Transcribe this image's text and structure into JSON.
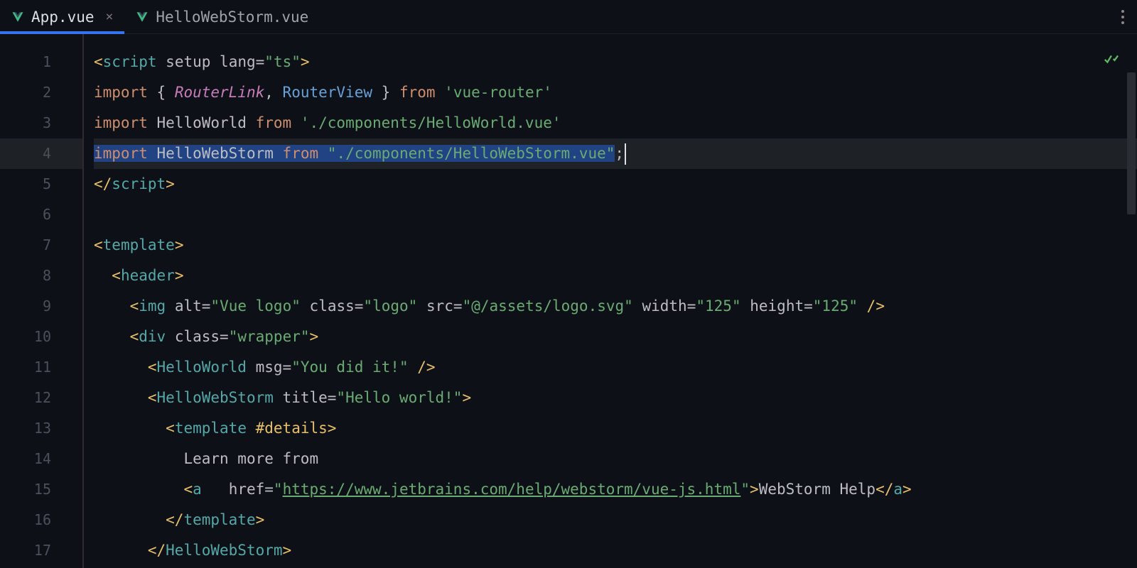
{
  "tabs": [
    {
      "label": "App.vue",
      "active": true,
      "closeable": true
    },
    {
      "label": "HelloWebStorm.vue",
      "active": false,
      "closeable": false
    }
  ],
  "icons": {
    "vue": "vue-icon",
    "close": "×",
    "kebab": "kebab-menu-icon",
    "check": "check-icon"
  },
  "colors": {
    "accent": "#3574f0",
    "selection": "#214283",
    "keyword": "#cf8e6d",
    "tag": "#56a8a8",
    "string": "#6aab73",
    "bracket": "#e8bf6a"
  },
  "line_numbers": [
    "1",
    "2",
    "3",
    "4",
    "5",
    "6",
    "7",
    "8",
    "9",
    "10",
    "11",
    "12",
    "13",
    "14",
    "15",
    "16",
    "17"
  ],
  "highlighted_line": 4,
  "code": {
    "l1": {
      "open": "<",
      "tag": "script",
      "attr1": "setup",
      "attr2": "lang",
      "eq": "=",
      "q": "\"",
      "val": "ts",
      "close": ">"
    },
    "l2": {
      "kw": "import",
      "lb": "{ ",
      "a": "RouterLink",
      "comma": ", ",
      "b": "RouterView",
      "rb": " }",
      "from": "from",
      "q": "'",
      "path": "vue-router"
    },
    "l3": {
      "kw": "import",
      "name": "HelloWorld",
      "from": "from",
      "q": "'",
      "path": "./components/HelloWorld.vue"
    },
    "l4": {
      "kw": "import",
      "name": "HelloWebStorm",
      "from": "from",
      "q": "\"",
      "path": "./components/HelloWebStorm.vue",
      "semi": ";"
    },
    "l5": {
      "open": "</",
      "tag": "script",
      "close": ">"
    },
    "l7": {
      "open": "<",
      "tag": "template",
      "close": ">"
    },
    "l8": {
      "open": "<",
      "tag": "header",
      "close": ">"
    },
    "l9": {
      "open": "<",
      "tag": "img",
      "a1": "alt",
      "v1": "Vue logo",
      "a2": "class",
      "v2": "logo",
      "a3": "src",
      "v3": "@/assets/logo.svg",
      "a4": "width",
      "v4": "125",
      "a5": "height",
      "v5": "125",
      "close": "/>"
    },
    "l10": {
      "open": "<",
      "tag": "div",
      "a1": "class",
      "v1": "wrapper",
      "close": ">"
    },
    "l11": {
      "open": "<",
      "tag": "HelloWorld",
      "a1": "msg",
      "v1": "You did it!",
      "close": "/>"
    },
    "l12": {
      "open": "<",
      "tag": "HelloWebStorm",
      "a1": "title",
      "v1": "Hello world!",
      "close": ">"
    },
    "l13": {
      "open": "<",
      "tag": "template",
      "slot": "#details",
      "close": ">"
    },
    "l14": {
      "text": "Learn more from"
    },
    "l15": {
      "open": "<",
      "tag": "a",
      "a1": "href",
      "url": "https://www.jetbrains.com/help/webstorm/vue-js.html",
      "close": ">",
      "text": "WebStorm Help",
      "copen": "</",
      "ctag": "a",
      "cclose": ">"
    },
    "l16": {
      "open": "</",
      "tag": "template",
      "close": ">"
    },
    "l17": {
      "open": "</",
      "tag": "HelloWebStorm",
      "close": ">"
    }
  }
}
